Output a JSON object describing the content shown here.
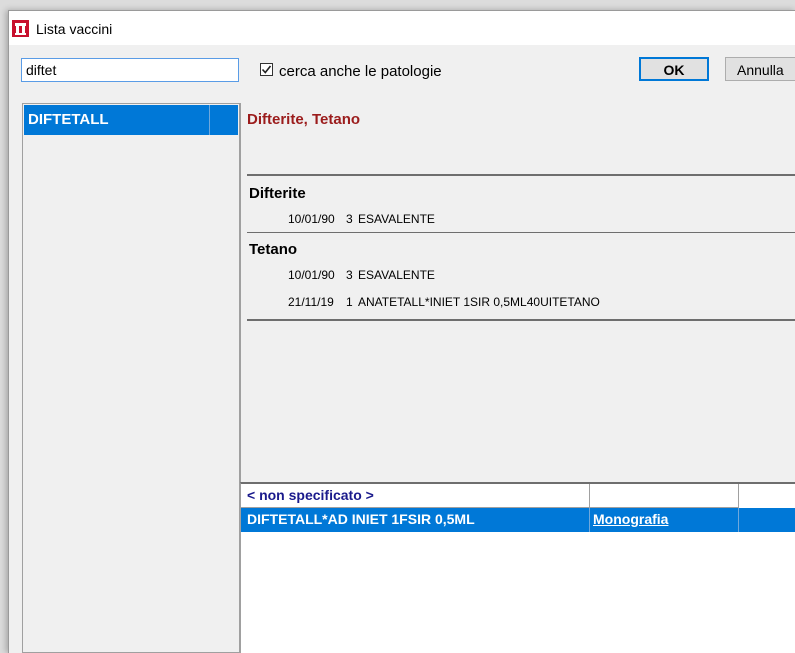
{
  "window": {
    "title": "Lista vaccini"
  },
  "search": {
    "value": "diftet"
  },
  "options": {
    "include_diseases_label": "cerca anche le patologie",
    "include_diseases_checked": true
  },
  "buttons": {
    "ok_label": "OK",
    "cancel_label": "Annulla"
  },
  "vaccine_list": {
    "items": [
      {
        "label": "DIFTETALL",
        "selected": true
      }
    ]
  },
  "detail": {
    "title": "Difterite, Tetano",
    "groups": [
      {
        "name": "Difterite",
        "entries": [
          {
            "date": "10/01/90",
            "dose": "3",
            "product": "ESAVALENTE"
          }
        ]
      },
      {
        "name": "Tetano",
        "entries": [
          {
            "date": "10/01/90",
            "dose": "3",
            "product": "ESAVALENTE"
          },
          {
            "date": "21/11/19",
            "dose": "1",
            "product": "ANATETALL*INIET 1SIR 0,5ML40UITETANO"
          }
        ]
      }
    ]
  },
  "products": {
    "rows": [
      {
        "name": "< non specificato >",
        "link": "",
        "selected": false
      },
      {
        "name": "DIFTETALL*AD INIET 1FSIR 0,5ML",
        "link": "Monografia",
        "selected": true
      }
    ]
  },
  "colors": {
    "accent": "#0078d7",
    "title_red": "#9b1c1c",
    "link_blue": "#1a1a8c"
  }
}
